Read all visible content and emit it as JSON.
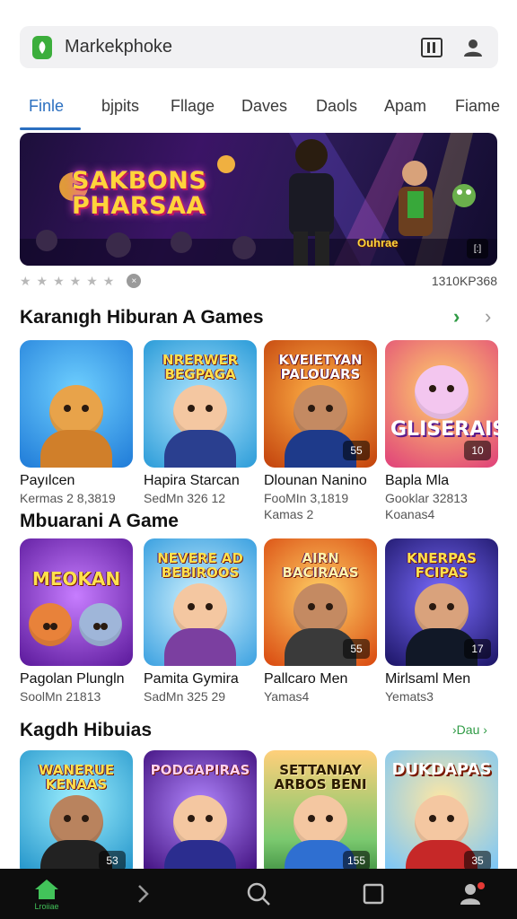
{
  "search": {
    "text": "Markekphoke"
  },
  "tabs": [
    {
      "label": "Finle",
      "active": true
    },
    {
      "label": "bjpits"
    },
    {
      "label": "Fllage"
    },
    {
      "label": "Daves"
    },
    {
      "label": "Daols"
    },
    {
      "label": "Apam"
    },
    {
      "label": "Fiame"
    }
  ],
  "banner": {
    "title_line1": "SAKBONS",
    "title_line2": "PHARSAA",
    "subtitle": "Ouhrae",
    "badge": "[:]"
  },
  "banner_meta": {
    "stars": "★★★★★★",
    "count": "1310KP368"
  },
  "sections": [
    {
      "title": "Karanıgh Hiburan A Games",
      "items": [
        {
          "art": "",
          "title": "Payılcen",
          "sub1": "Kermas 2 8,3819",
          "badge": ""
        },
        {
          "art": "NRERWER BEGPAGA",
          "title": "Hapira Starcan",
          "sub1": "SedMn 326 12",
          "badge": ""
        },
        {
          "art": "KVEIETYAN PALOUARS",
          "title": "Dlounan Nanino",
          "sub1": "FooMIn 3,1819",
          "sub2": "Kamas 2",
          "badge": "55"
        },
        {
          "art": "GLISERAIS",
          "title": "Bapla Mla",
          "sub1": "Gooklar 32813",
          "sub2": "Koanas4",
          "badge": "10"
        }
      ]
    },
    {
      "title": "Mbuarani A Game",
      "items": [
        {
          "art": "MEOKAN",
          "title": "Pagolan Plungln",
          "sub1": "SoolMn 21813",
          "badge": ""
        },
        {
          "art": "NEVERE AD BEBIROOS",
          "title": "Pamita Gymira",
          "sub1": "SadMn 325 29",
          "badge": ""
        },
        {
          "art": "AIRN BACIRAAS",
          "title": "Pallcaro Men",
          "sub1": "Yamas4",
          "badge": "55"
        },
        {
          "art": "KNERPAS FCIPAS",
          "title": "Mirlsaml Men",
          "sub1": "Yemats3",
          "badge": "17"
        }
      ]
    },
    {
      "title": "Kagdh Hibuias",
      "more": "Dau",
      "items": [
        {
          "art": "WANERUE KENAAS",
          "title": "",
          "sub1": "",
          "badge": "53"
        },
        {
          "art": "PODGAPIRAS",
          "title": "",
          "sub1": "",
          "badge": ""
        },
        {
          "art": "SETTANIAY ARBOS BENI",
          "title": "",
          "sub1": "",
          "badge": "155"
        },
        {
          "art": "DUKDAPAS",
          "title": "",
          "sub1": "",
          "badge": "35"
        }
      ]
    }
  ],
  "bottom_nav": {
    "home_label": "Lroiiae"
  },
  "colors": {
    "accent_blue": "#2b6fc0",
    "accent_green": "#2e9a44",
    "nav_bg": "#0d0d0d"
  }
}
